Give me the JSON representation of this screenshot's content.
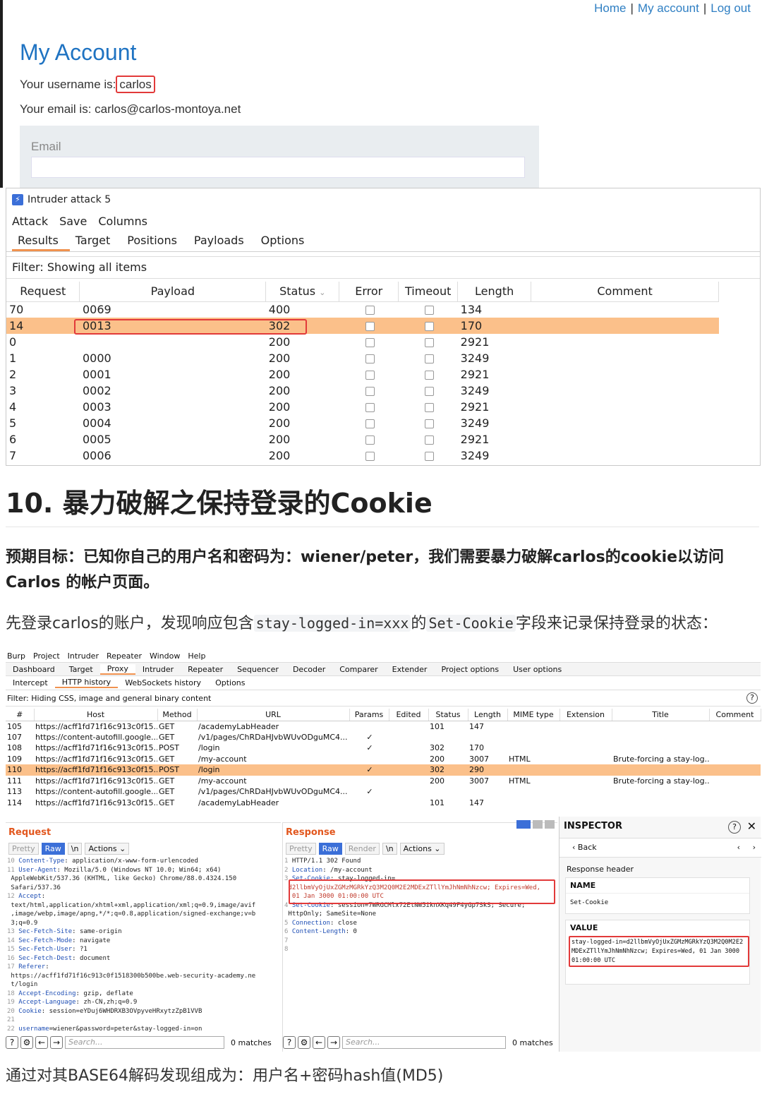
{
  "web": {
    "nav": [
      "Home",
      "|",
      "My account",
      "|",
      "Log out"
    ],
    "title": "My Account",
    "username_label": "Your username is:",
    "username": "carlos",
    "email_line": "Your email is: carlos@carlos-montoya.net",
    "email_field_label": "Email"
  },
  "intruder": {
    "window_title": "Intruder attack 5",
    "menu": [
      "Attack",
      "Save",
      "Columns"
    ],
    "tabs": [
      "Results",
      "Target",
      "Positions",
      "Payloads",
      "Options"
    ],
    "filter": "Filter: Showing all items",
    "columns": [
      "Request",
      "Payload",
      "Status",
      "Error",
      "Timeout",
      "Length",
      "Comment"
    ],
    "rows": [
      {
        "request": "70",
        "payload": "0069",
        "status": "400",
        "length": "134"
      },
      {
        "request": "14",
        "payload": "0013",
        "status": "302",
        "length": "170",
        "highlight": true
      },
      {
        "request": "0",
        "payload": "",
        "status": "200",
        "length": "2921"
      },
      {
        "request": "1",
        "payload": "0000",
        "status": "200",
        "length": "3249"
      },
      {
        "request": "2",
        "payload": "0001",
        "status": "200",
        "length": "2921"
      },
      {
        "request": "3",
        "payload": "0002",
        "status": "200",
        "length": "3249"
      },
      {
        "request": "4",
        "payload": "0003",
        "status": "200",
        "length": "2921"
      },
      {
        "request": "5",
        "payload": "0004",
        "status": "200",
        "length": "3249"
      },
      {
        "request": "6",
        "payload": "0005",
        "status": "200",
        "length": "2921"
      },
      {
        "request": "7",
        "payload": "0006",
        "status": "200",
        "length": "3249"
      }
    ]
  },
  "article": {
    "heading": "10. 暴力破解之保持登录的Cookie",
    "goal": "预期目标：已知你自己的用户名和密码为：wiener/peter，我们需要暴力破解carlos的cookie以访问Carlos 的帐户页面。",
    "para1_a": "先登录carlos的账户，发现响应包含",
    "para1_code1": "stay-logged-in=xxx",
    "para1_b": "的",
    "para1_code2": "Set-Cookie",
    "para1_c": "字段来记录保持登录的状态：",
    "para2": "通过对其BASE64解码发现组成为：用户名+密码hash值(MD5)"
  },
  "burp": {
    "menu": [
      "Burp",
      "Project",
      "Intruder",
      "Repeater",
      "Window",
      "Help"
    ],
    "tabs": [
      "Dashboard",
      "Target",
      "Proxy",
      "Intruder",
      "Repeater",
      "Sequencer",
      "Decoder",
      "Comparer",
      "Extender",
      "Project options",
      "User options"
    ],
    "subtabs": [
      "Intercept",
      "HTTP history",
      "WebSockets history",
      "Options"
    ],
    "filter": "Filter: Hiding CSS, image and general binary content",
    "columns": [
      "#",
      "Host",
      "Method",
      "URL",
      "Params",
      "Edited",
      "Status",
      "Length",
      "MIME type",
      "Extension",
      "Title",
      "Comment"
    ],
    "rows": [
      {
        "n": "105",
        "host": "https://acff1fd71f16c913c0f15...",
        "method": "GET",
        "url": "/academyLabHeader",
        "params": "",
        "status": "101",
        "length": "147",
        "mime": "",
        "title": ""
      },
      {
        "n": "107",
        "host": "https://content-autofill.google...",
        "method": "GET",
        "url": "/v1/pages/ChRDaHJvbWUvODguMC4...",
        "params": "✓",
        "status": "",
        "length": "",
        "mime": "",
        "title": ""
      },
      {
        "n": "108",
        "host": "https://acff1fd71f16c913c0f15...",
        "method": "POST",
        "url": "/login",
        "params": "✓",
        "status": "302",
        "length": "170",
        "mime": "",
        "title": ""
      },
      {
        "n": "109",
        "host": "https://acff1fd71f16c913c0f15...",
        "method": "GET",
        "url": "/my-account",
        "params": "",
        "status": "200",
        "length": "3007",
        "mime": "HTML",
        "title": "Brute-forcing a stay-log..."
      },
      {
        "n": "110",
        "host": "https://acff1fd71f16c913c0f15...",
        "method": "POST",
        "url": "/login",
        "params": "✓",
        "status": "302",
        "length": "290",
        "mime": "",
        "title": "",
        "highlight": true
      },
      {
        "n": "111",
        "host": "https://acff1fd71f16c913c0f15...",
        "method": "GET",
        "url": "/my-account",
        "params": "",
        "status": "200",
        "length": "3007",
        "mime": "HTML",
        "title": "Brute-forcing a stay-log..."
      },
      {
        "n": "113",
        "host": "https://content-autofill.google...",
        "method": "GET",
        "url": "/v1/pages/ChRDaHJvbWUvODguMC4...",
        "params": "✓",
        "status": "",
        "length": "",
        "mime": "",
        "title": ""
      },
      {
        "n": "114",
        "host": "https://acff1fd71f16c913c0f15...",
        "method": "GET",
        "url": "/academyLabHeader",
        "params": "",
        "status": "101",
        "length": "147",
        "mime": "",
        "title": ""
      }
    ],
    "request": {
      "title": "Request",
      "tabs": [
        "Pretty",
        "Raw",
        "\\n",
        "Actions ⌄"
      ],
      "lines": [
        [
          "10",
          "Content-Type",
          ": application/x-www-form-urlencoded"
        ],
        [
          "11",
          "User-Agent",
          ": Mozilla/5.0 (Windows NT 10.0; Win64; x64)"
        ],
        [
          "",
          "",
          "AppleWebKit/537.36 (KHTML, like Gecko) Chrome/88.0.4324.150"
        ],
        [
          "",
          "",
          "Safari/537.36"
        ],
        [
          "12",
          "Accept",
          ":"
        ],
        [
          "",
          "",
          "text/html,application/xhtml+xml,application/xml;q=0.9,image/avif"
        ],
        [
          "",
          "",
          ",image/webp,image/apng,*/*;q=0.8,application/signed-exchange;v=b"
        ],
        [
          "",
          "",
          "3;q=0.9"
        ],
        [
          "13",
          "Sec-Fetch-Site",
          ": same-origin"
        ],
        [
          "14",
          "Sec-Fetch-Mode",
          ": navigate"
        ],
        [
          "15",
          "Sec-Fetch-User",
          ": ?1"
        ],
        [
          "16",
          "Sec-Fetch-Dest",
          ": document"
        ],
        [
          "17",
          "Referer",
          ":"
        ],
        [
          "",
          "",
          "https://acff1fd71f16c913c0f1518300b500be.web-security-academy.ne"
        ],
        [
          "",
          "",
          "t/login"
        ],
        [
          "18",
          "Accept-Encoding",
          ": gzip, deflate"
        ],
        [
          "19",
          "Accept-Language",
          ": zh-CN,zh;q=0.9"
        ],
        [
          "20",
          "Cookie",
          ": session=eYDuj6WHDRXB3OVpyveHRxytzZpB1VVB"
        ],
        [
          "21",
          "",
          ""
        ],
        [
          "22",
          "username",
          "=wiener&password=peter&stay-logged-in=on"
        ]
      ],
      "search": "Search...",
      "matches": "0 matches"
    },
    "response": {
      "title": "Response",
      "tabs": [
        "Pretty",
        "Raw",
        "Render",
        "\\n",
        "Actions ⌄"
      ],
      "lines": [
        [
          "1",
          "",
          "HTTP/1.1 302 Found"
        ],
        [
          "2",
          "Location",
          ": /my-account"
        ],
        [
          "3",
          "Set-Cookie",
          ": stay-logged-in="
        ],
        [
          "",
          "",
          "d2llbmVyOjUxZGMzMGRkYzQ3M2Q0M2E2MDExZTllYmJhNmNhNzcw; Expires=Wed,"
        ],
        [
          "",
          "",
          " 01 Jan 3000 01:00:00 UTC"
        ],
        [
          "4",
          "Set-Cookie",
          ": session=7WRGCMlx72EtNW5iknXKq49F4yGp7SkS; Secure;"
        ],
        [
          "",
          "",
          "HttpOnly; SameSite=None"
        ],
        [
          "5",
          "Connection",
          ": close"
        ],
        [
          "6",
          "Content-Length",
          ": 0"
        ],
        [
          "7",
          "",
          ""
        ],
        [
          "8",
          "",
          ""
        ]
      ],
      "search": "Search...",
      "matches": "0 matches"
    },
    "inspector": {
      "title": "INSPECTOR",
      "back": "Back",
      "section": "Response header",
      "name_label": "NAME",
      "name_value": "Set-Cookie",
      "value_label": "VALUE",
      "value_value": "stay-logged-in=d2llbmVyOjUxZGMzMGRkYzQ3M2Q0M2E2MDExZTllYmJhNmNhNzcw; Expires=Wed, 01 Jan 3000 01:00:00 UTC"
    }
  }
}
